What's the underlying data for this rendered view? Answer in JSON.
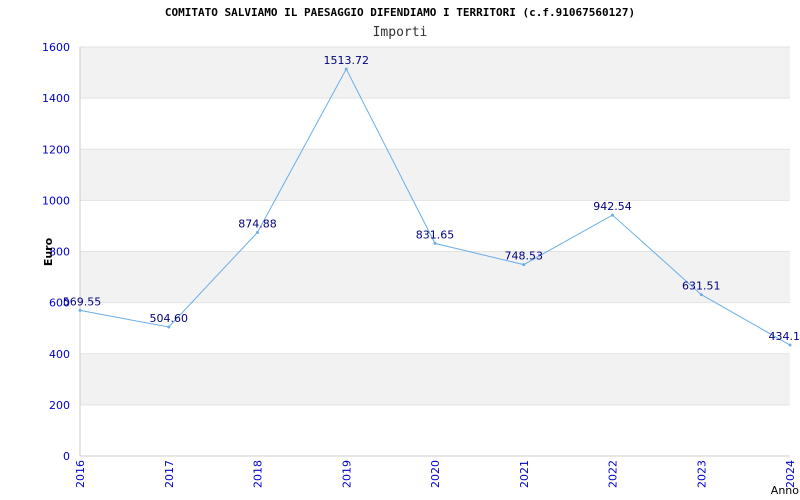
{
  "title": "COMITATO SALVIAMO IL PAESAGGIO DIFENDIAMO I TERRITORI (c.f.91067560127)",
  "subtitle": "Importi",
  "chart_data": {
    "type": "line",
    "x": [
      "2016",
      "2017",
      "2018",
      "2019",
      "2020",
      "2021",
      "2022",
      "2023",
      "2024"
    ],
    "series": [
      {
        "values": [
          569.55,
          504.6,
          874.88,
          1513.72,
          831.65,
          748.53,
          942.54,
          631.51,
          434.1
        ],
        "labels": [
          "569.55",
          "504.60",
          "874.88",
          "1513.72",
          "831.65",
          "748.53",
          "942.54",
          "631.51",
          "434.1"
        ]
      }
    ],
    "ylabel": "Euro",
    "xlabel": "Anno",
    "ylim": [
      0,
      1600
    ],
    "yticks": [
      0,
      200,
      400,
      600,
      800,
      1000,
      1200,
      1400,
      1600
    ],
    "grid": "horizontal alternating bands",
    "colors": {
      "line": "#6aaee8",
      "band": "#f2f2f2",
      "axis_text": "#0000cc",
      "label_text": "#000080"
    }
  }
}
